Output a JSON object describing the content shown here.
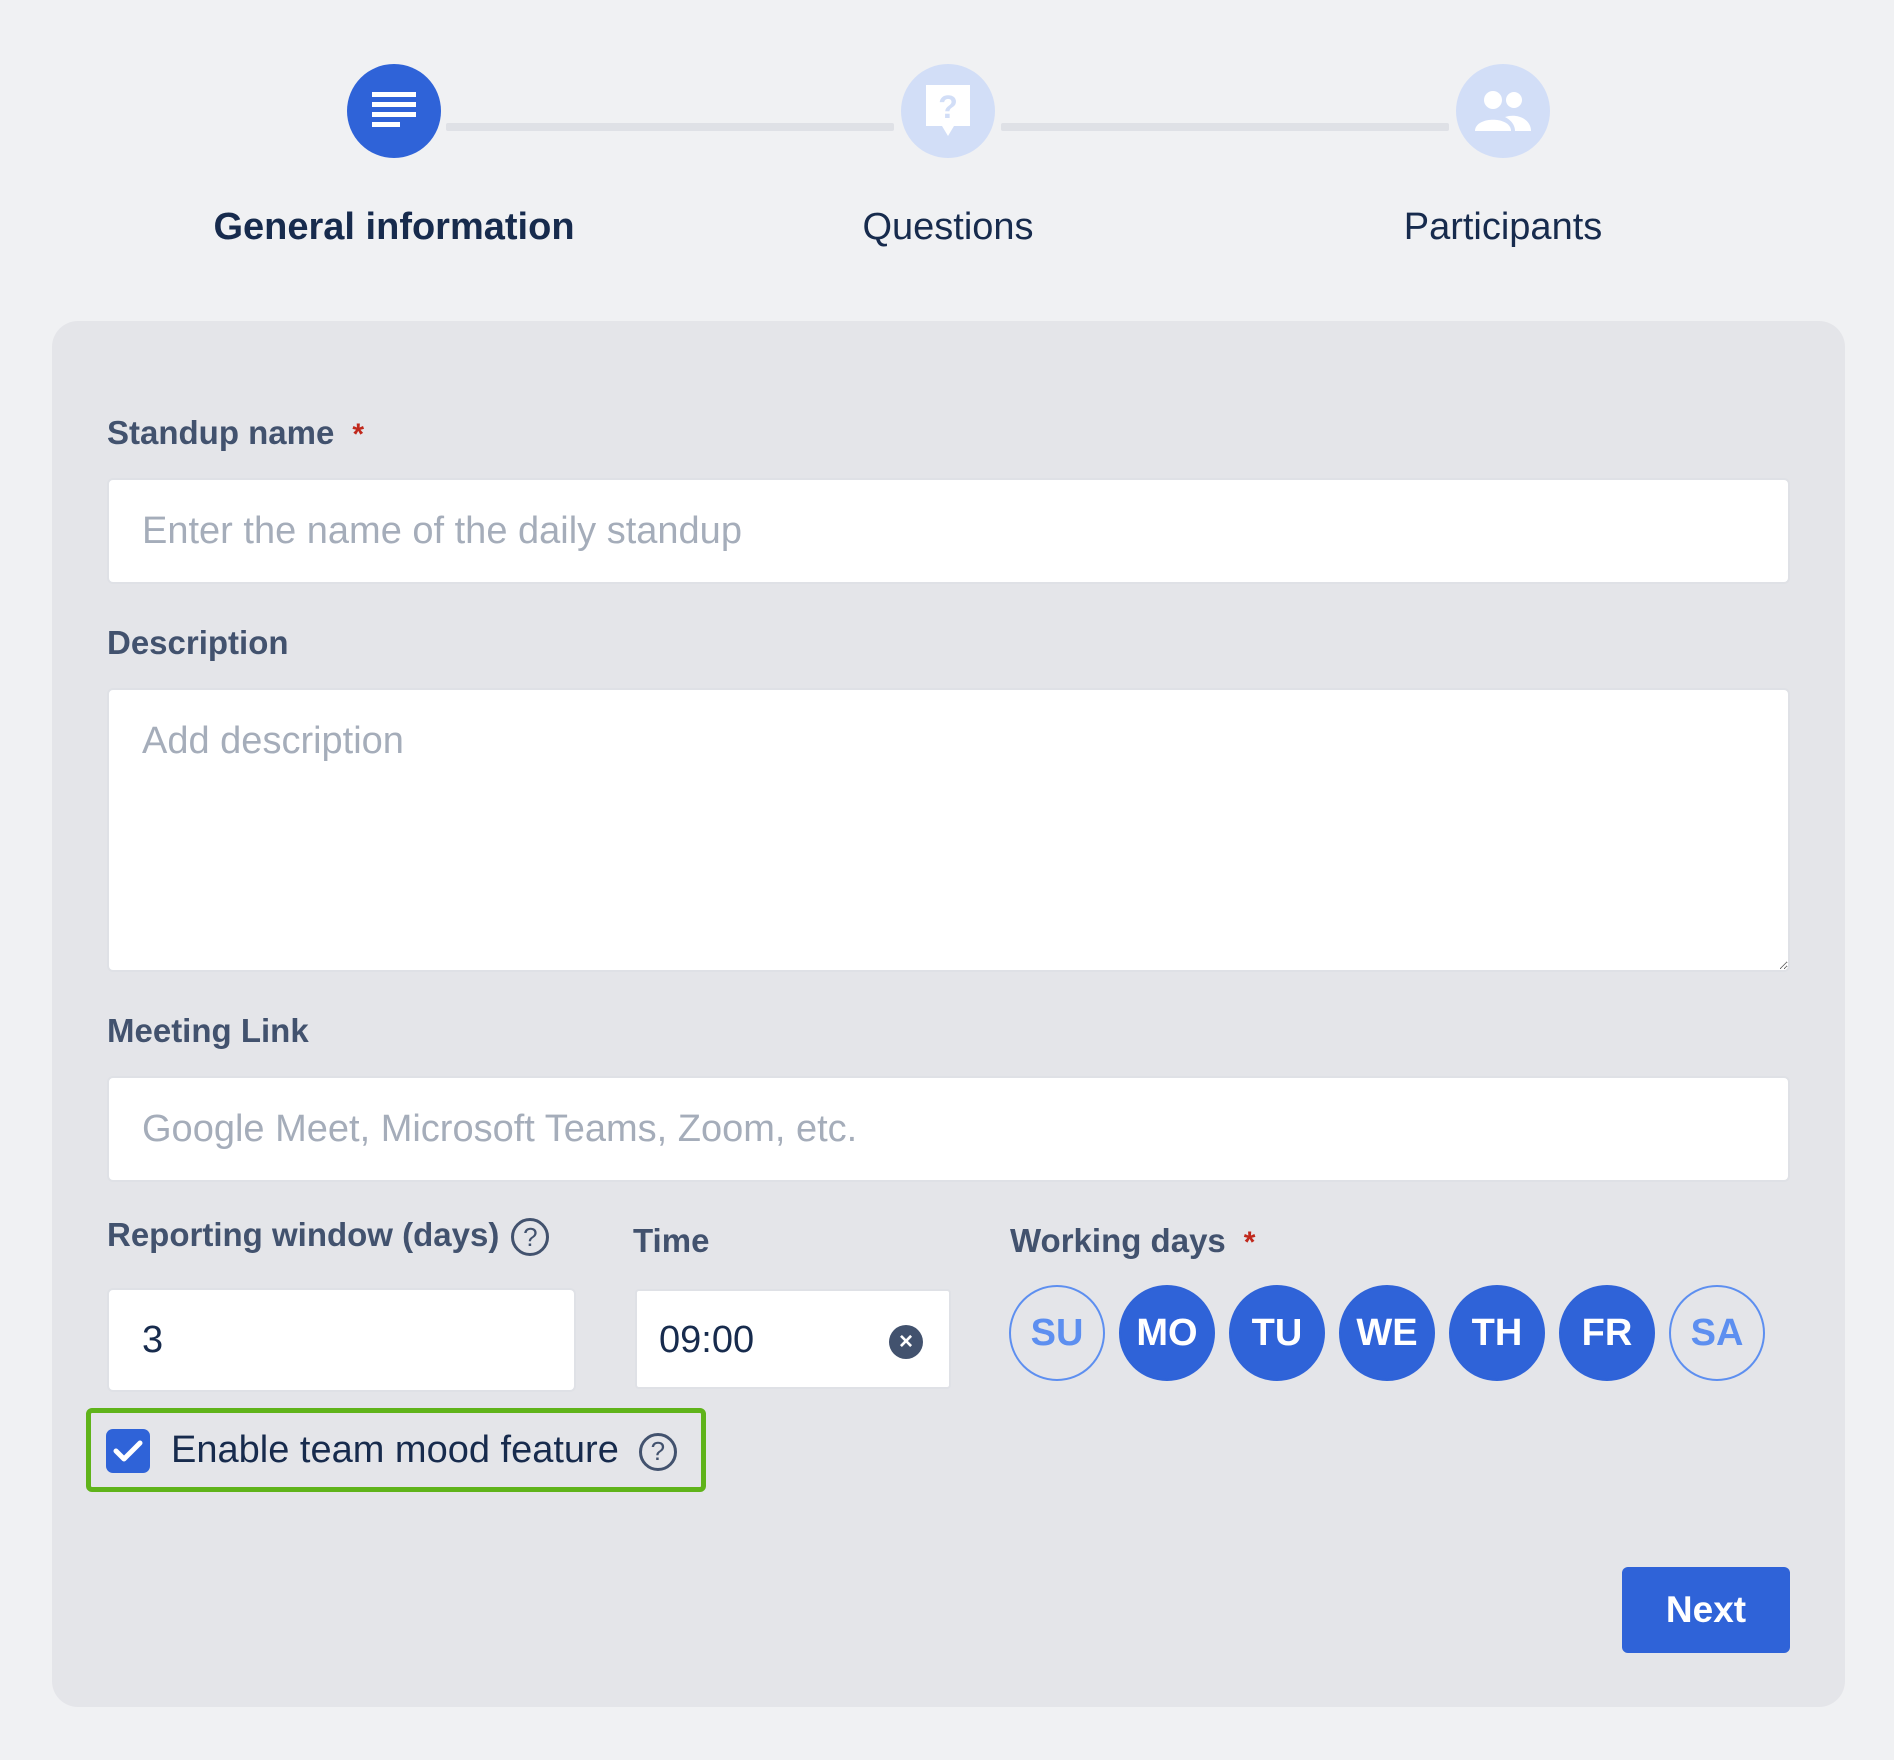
{
  "steps": [
    {
      "label": "General information",
      "icon": "document-lines-icon",
      "state": "active"
    },
    {
      "label": "Questions",
      "icon": "question-bubble-icon",
      "state": "inactive"
    },
    {
      "label": "Participants",
      "icon": "people-icon",
      "state": "inactive"
    }
  ],
  "form": {
    "standup_name": {
      "label": "Standup name",
      "required_mark": "*",
      "placeholder": "Enter the name of the daily standup",
      "value": ""
    },
    "description": {
      "label": "Description",
      "placeholder": "Add description",
      "value": ""
    },
    "meeting_link": {
      "label": "Meeting Link",
      "placeholder": "Google Meet, Microsoft Teams, Zoom, etc.",
      "value": ""
    },
    "reporting_window": {
      "label": "Reporting window (days)",
      "help": "?",
      "value": "3"
    },
    "time": {
      "label": "Time",
      "value": "09:00",
      "clear": "×"
    },
    "working_days": {
      "label": "Working days",
      "required_mark": "*",
      "days": [
        {
          "label": "SU",
          "selected": false
        },
        {
          "label": "MO",
          "selected": true
        },
        {
          "label": "TU",
          "selected": true
        },
        {
          "label": "WE",
          "selected": true
        },
        {
          "label": "TH",
          "selected": true
        },
        {
          "label": "FR",
          "selected": true
        },
        {
          "label": "SA",
          "selected": false
        }
      ]
    },
    "team_mood": {
      "label": "Enable team mood feature",
      "checked": true,
      "help": "?"
    }
  },
  "actions": {
    "next_label": "Next"
  },
  "colors": {
    "primary": "#2f63d8",
    "highlight": "#5fb31a",
    "required": "#c0281c"
  }
}
